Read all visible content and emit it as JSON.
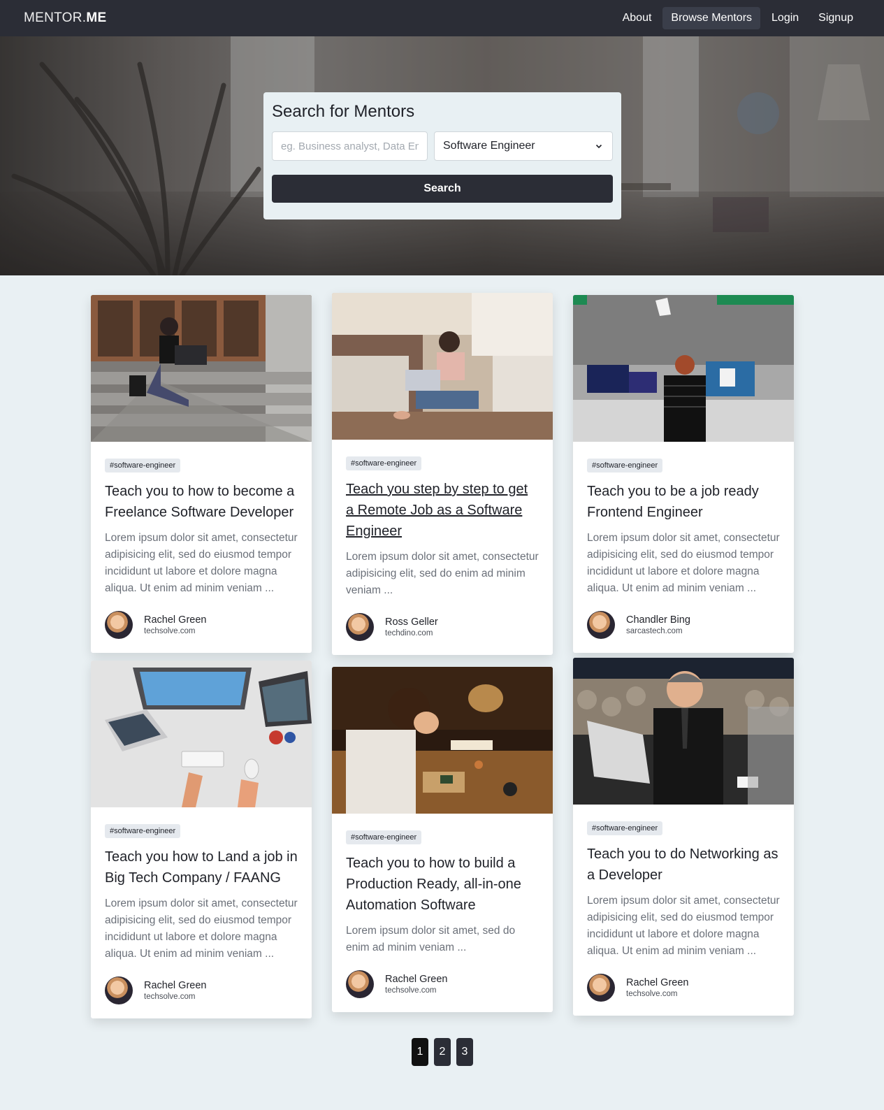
{
  "nav": {
    "brand_thin": "MENTOR.",
    "brand_bold": "ME",
    "links": [
      "About",
      "Browse Mentors",
      "Login",
      "Signup"
    ],
    "active": "Browse Mentors"
  },
  "search": {
    "title": "Search for Mentors",
    "placeholder": "eg. Business analyst, Data Engineer",
    "selected_role": "Software Engineer",
    "button_label": "Search"
  },
  "cards": [
    {
      "tag": "#software-engineer",
      "title": "Teach you to how to become a Freelance Software Developer",
      "description": "Lorem ipsum dolor sit amet, consectetur adipisicing elit, sed do eiusmod tempor incididunt ut labore et dolore magna aliqua. Ut enim ad minim veniam ...",
      "author": "Rachel Green",
      "site": "techsolve.com",
      "image": "woman-on-stairs-photo"
    },
    {
      "tag": "#software-engineer",
      "title": "Teach you step by step to get a Remote Job as a Software Engineer",
      "description": "Lorem ipsum dolor sit amet, consectetur adipisicing elit, sed do enim ad minim veniam ...",
      "author": "Ross Geller",
      "site": "techdino.com",
      "image": "woman-with-laptop-on-floor-photo"
    },
    {
      "tag": "#software-engineer",
      "title": "Teach you to be a job ready Frontend Engineer",
      "description": "Lorem ipsum dolor sit amet, consectetur adipisicing elit, sed do eiusmod tempor incididunt ut labore et dolore magna aliqua. Ut enim ad minim veniam ...",
      "author": "Chandler Bing",
      "site": "sarcastech.com",
      "image": "office-desks-photo"
    },
    {
      "tag": "#software-engineer",
      "title": "Teach you how to Land a job in Big Tech Company / FAANG",
      "description": "Lorem ipsum dolor sit amet, consectetur adipisicing elit, sed do eiusmod tempor incididunt ut labore et dolore magna aliqua. Ut enim ad minim veniam ...",
      "author": "Rachel Green",
      "site": "techsolve.com",
      "image": "desk-with-monitors-photo"
    },
    {
      "tag": "#software-engineer",
      "title": "Teach you to how to build a Production Ready, all-in-one Automation Software",
      "description": "Lorem ipsum dolor sit amet, sed do enim ad minim veniam ...",
      "author": "Rachel Green",
      "site": "techsolve.com",
      "image": "boy-soldering-photo"
    },
    {
      "tag": "#software-engineer",
      "title": "Teach you to do Networking as a Developer",
      "description": "Lorem ipsum dolor sit amet, consectetur adipisicing elit, sed do eiusmod tempor incididunt ut labore et dolore magna aliqua. Ut enim ad minim veniam ...",
      "author": "Rachel Green",
      "site": "techsolve.com",
      "image": "man-in-suit-with-laptop-photo"
    }
  ],
  "pagination": {
    "pages": [
      "1",
      "2",
      "3"
    ],
    "current": "1"
  }
}
